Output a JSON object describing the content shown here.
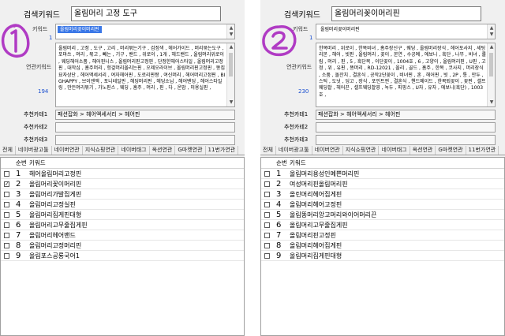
{
  "panels": [
    {
      "search_label": "검색키워드",
      "search_value": "올림머리 고정 도구",
      "keyword_label": "키워드",
      "keyword_count": "1",
      "keyword_tag": "올림머리꽂이머리핀",
      "keyword_tag_selected": true,
      "related_label": "연관키워드",
      "related_count": "194",
      "related_text": "올림머리 , 고정 , 도구 , 고리 , 머리묶는기구 , 검정색 , 헤어가이드 , 머리묶는도구 , 포마쓰 , 머리 , 묶고 , 빼는 , 기구 , 밴드 , 위로이 , 1개 , 헤드밴드 , 올림머리위로이 , 웨딩헤어소품 , 헤어핀니스 , 올림머리핀고정핀 , 단정한헤어스타일 , 올림머리고정핀 , 대작심 , 흠주머리 , 헝겊머리올리는핀 , 오제오라이브 , 올림머리핀고정핀 , 똥집묘자상단 , 헤어액세서리 , 여자헤어핀 , 도로리핀짱 , 여신머리 , 헤어머리고정핀 , BIGHAPPY , 브이엔액 , 포니테일핀 , 헤딩머리핀 , 헤딩소님 , 헤어밴딩 , 헤어스타일링 , 만든머리묶기 , 가노핀스 , 웨딩 , 흠주 , 머리 , 핀 , 다 , 온맘 , 미용실핀 ,",
      "categories": [
        {
          "label": "추천카테1",
          "value": "패션잡화 > 헤어액세서리 > 헤어핀"
        },
        {
          "label": "추천카테2",
          "value": ""
        },
        {
          "label": "추천카테3",
          "value": ""
        }
      ],
      "tabs": [
        "전체",
        "네이버광고툴",
        "네이버연관",
        "지식쇼핑연관",
        "네이버태그",
        "옥션연관",
        "G마켓연관",
        "11번가연관"
      ],
      "col_seq": "순번",
      "col_keyword": "키워드",
      "rows": [
        {
          "num": "1",
          "keyword": "헤어올림머리고정핀",
          "checked": false
        },
        {
          "num": "2",
          "keyword": "올림머리꽂이머리핀",
          "checked": true
        },
        {
          "num": "3",
          "keyword": "올림머리가발집게핀",
          "checked": false
        },
        {
          "num": "4",
          "keyword": "올림머리고정실핀",
          "checked": false
        },
        {
          "num": "5",
          "keyword": "올림머리집게핀대형",
          "checked": false
        },
        {
          "num": "6",
          "keyword": "올림머리고무줄집게핀",
          "checked": false
        },
        {
          "num": "7",
          "keyword": "올림머리헤어밴드",
          "checked": false
        },
        {
          "num": "8",
          "keyword": "올림머리고정머리핀",
          "checked": false
        },
        {
          "num": "9",
          "keyword": "올림포스공룡국어1",
          "checked": false
        }
      ],
      "annotation_color": "#b03bc4"
    },
    {
      "search_label": "검색키워드",
      "search_value": "올림머리꽂이머리핀",
      "keyword_label": "키워드",
      "keyword_count": "1",
      "keyword_tag": "올림머리꽂이머리핀",
      "keyword_tag_selected": false,
      "related_label": "연관키워드",
      "related_count": "230",
      "related_text": "한복머리 , 위로이 , 한복비녀 , 흠주장신구 , 웨딩 , 올림머리장식 , 헤어포사지 , 세팅리본 , 헤어 , 빗핀 , 올림머리 , 꽂이 , 본연 , 수공예 , 에보니 , 흑단 , 나무 , 비녀 , 롤림 , 머리 , 핀 , 5 , 흑단목 , 이단꽂이 , 1004호 , 6 , 고양이 , 올림머리핀 , U핀 , 고정 , 위 , 유핀 , 똥머리 , RD-12021 , 올리 , 골드 , 흠주 , 한복 , 코사지 , 머리장식 , 소품 , 돌잔치 , 결혼식 , 공작2단꽂이 , 비녀핀 , 혼 , 헤어핀 , 빗 , 2P , 통 , 만두 , 스틱 , 도넛 , 딩고 , 장식 , 포인트핀 , 결혼식 , 핸드메이드 , 한복퇴꽂이 , 꽃핀 , 셀프웨딩촬 , 헤어끈 , 셀프웨딩촬영 , 녹두 , 피핑스 , U자 , 유자 , 에보니(흑단) , 1003호 ,",
      "categories": [
        {
          "label": "추천카테1",
          "value": "패션잡화 > 헤어액세서리 > 헤어핀"
        },
        {
          "label": "추천카테2",
          "value": ""
        },
        {
          "label": "추천카테3",
          "value": ""
        }
      ],
      "tabs": [
        "전체",
        "네이버광고툴",
        "네이버연관",
        "지식쇼핑연관",
        "네이버태그",
        "옥션연관",
        "G마켓연관",
        "11번가연관"
      ],
      "col_seq": "순번",
      "col_keyword": "키워드",
      "rows": [
        {
          "num": "1",
          "keyword": "올림머리용성인예쁜머리핀",
          "checked": false
        },
        {
          "num": "2",
          "keyword": "여성머리핀올림머리핀",
          "checked": false
        },
        {
          "num": "3",
          "keyword": "올린머리헤어집게핀",
          "checked": false
        },
        {
          "num": "4",
          "keyword": "올림머리헤어고정핀",
          "checked": false
        },
        {
          "num": "5",
          "keyword": "올림똥머리앙고머리와이어머리끈",
          "checked": false
        },
        {
          "num": "6",
          "keyword": "올림머리고무줄집게핀",
          "checked": false
        },
        {
          "num": "7",
          "keyword": "올림머리핀고정핀",
          "checked": false
        },
        {
          "num": "8",
          "keyword": "올림머리헤어집게핀",
          "checked": false
        },
        {
          "num": "9",
          "keyword": "올림머리집게핀대형",
          "checked": false
        }
      ],
      "annotation_color": "#b03bc4"
    }
  ]
}
